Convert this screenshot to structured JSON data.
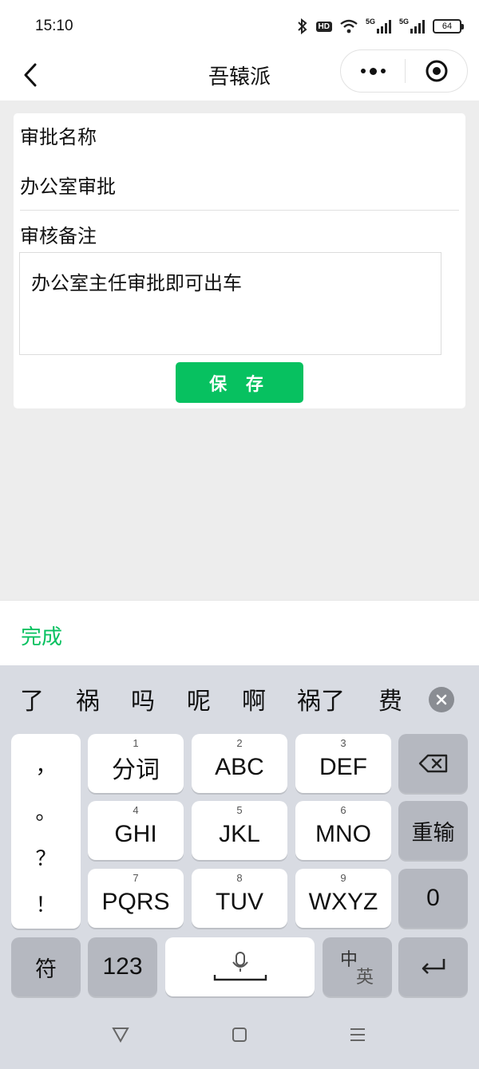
{
  "status_bar": {
    "time": "15:10",
    "battery": "64",
    "hd_label": "HD",
    "sim1_label": "5G",
    "sim2_label": "5G"
  },
  "nav": {
    "title": "吾辕派"
  },
  "form": {
    "name_label": "审批名称",
    "name_value": "办公室审批",
    "remark_label": "审核备注",
    "remark_value": "办公室主任审批即可出车",
    "save_label": "保 存"
  },
  "done_bar": {
    "done_label": "完成"
  },
  "keyboard": {
    "candidates": [
      "了",
      "祸",
      "吗",
      "呢",
      "啊",
      "祸了",
      "费"
    ],
    "punct": [
      "，",
      "。",
      "？",
      "！"
    ],
    "keys": {
      "k1": {
        "num": "1",
        "label": "分词"
      },
      "k2": {
        "num": "2",
        "label": "ABC"
      },
      "k3": {
        "num": "3",
        "label": "DEF"
      },
      "k4": {
        "num": "4",
        "label": "GHI"
      },
      "k5": {
        "num": "5",
        "label": "JKL"
      },
      "k6": {
        "num": "6",
        "label": "MNO"
      },
      "k7": {
        "num": "7",
        "label": "PQRS"
      },
      "k8": {
        "num": "8",
        "label": "TUV"
      },
      "k9": {
        "num": "9",
        "label": "WXYZ"
      },
      "k0": {
        "label": "0"
      },
      "reenter": "重输",
      "symbol": "符",
      "numeric": "123",
      "lang_zh": "中",
      "lang_en": "英"
    }
  },
  "colors": {
    "accent": "#07c160",
    "background": "#ededed",
    "keyboard_bg": "#d8dbe2"
  }
}
